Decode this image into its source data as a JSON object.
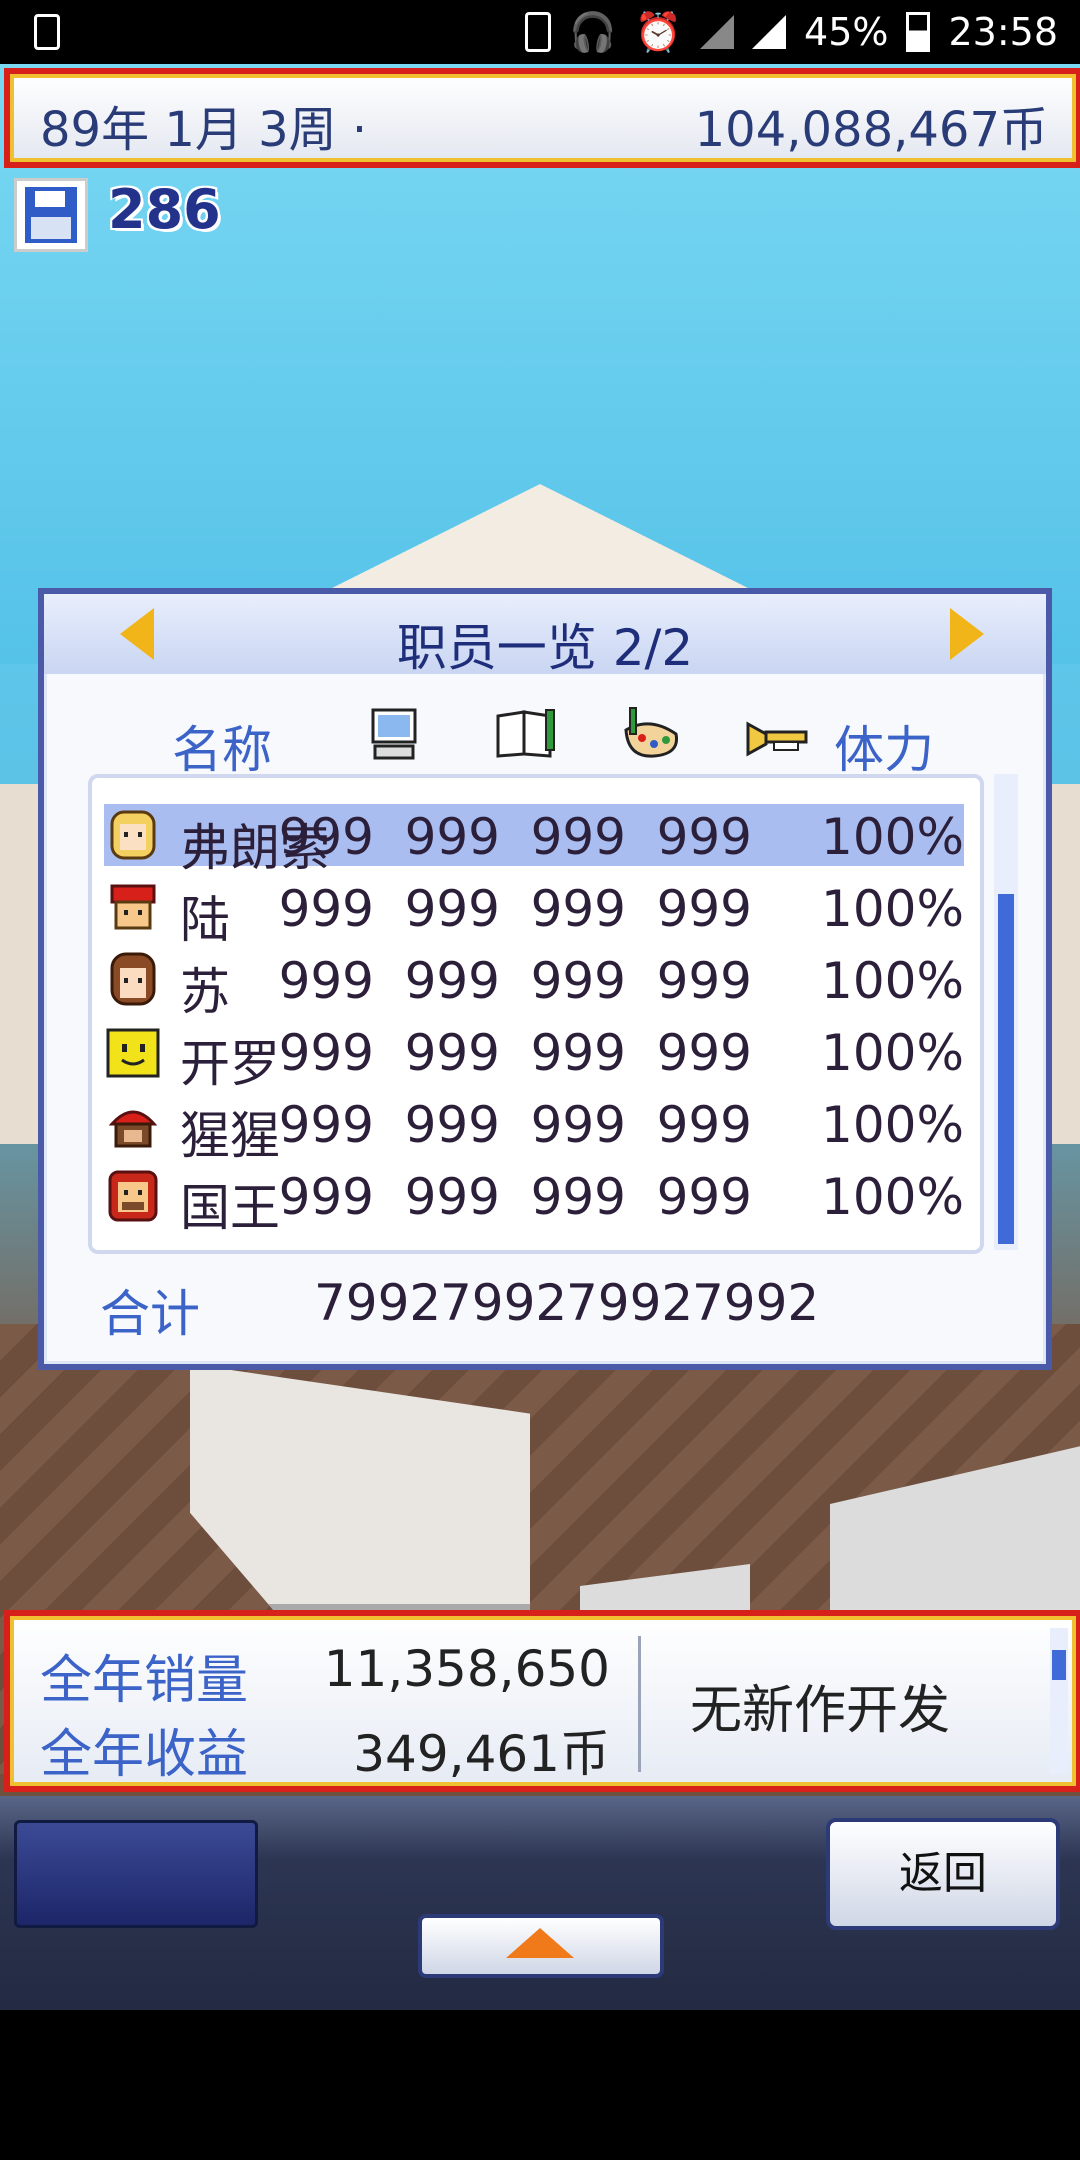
{
  "status_bar": {
    "battery": "45%",
    "time": "23:58"
  },
  "top_bar": {
    "date": "89年 1月 3周 ·",
    "money": "104,088,467币"
  },
  "save_count": "286",
  "dialog": {
    "title": "职员一览 2/2",
    "col_name": "名称",
    "col_stamina": "体力",
    "header_icons": [
      "computer-icon",
      "book-icon",
      "art-palette-icon",
      "trumpet-icon"
    ],
    "rows": [
      {
        "name": "弗朗索",
        "v1": "999",
        "v2": "999",
        "v3": "999",
        "v4": "999",
        "hp": "100%"
      },
      {
        "name": "陆",
        "v1": "999",
        "v2": "999",
        "v3": "999",
        "v4": "999",
        "hp": "100%"
      },
      {
        "name": "苏",
        "v1": "999",
        "v2": "999",
        "v3": "999",
        "v4": "999",
        "hp": "100%"
      },
      {
        "name": "开罗",
        "v1": "999",
        "v2": "999",
        "v3": "999",
        "v4": "999",
        "hp": "100%"
      },
      {
        "name": "猩猩",
        "v1": "999",
        "v2": "999",
        "v3": "999",
        "v4": "999",
        "hp": "100%"
      },
      {
        "name": "国王",
        "v1": "999",
        "v2": "999",
        "v3": "999",
        "v4": "999",
        "hp": "100%"
      }
    ],
    "total_label": "合计",
    "totals": [
      "7992",
      "7992",
      "7992",
      "7992"
    ]
  },
  "info_panel": {
    "sales_label": "全年销量",
    "sales_value": "11,358,650",
    "revenue_label": "全年收益",
    "revenue_value": "349,461币",
    "status": "无新作开发"
  },
  "controls": {
    "back_label": "返回"
  },
  "colors": {
    "frame_red": "#d8201a",
    "frame_gold": "#f0c030",
    "title_blue": "#1f2e7a",
    "label_blue": "#3b63c8",
    "selection": "#a9bdf0"
  }
}
